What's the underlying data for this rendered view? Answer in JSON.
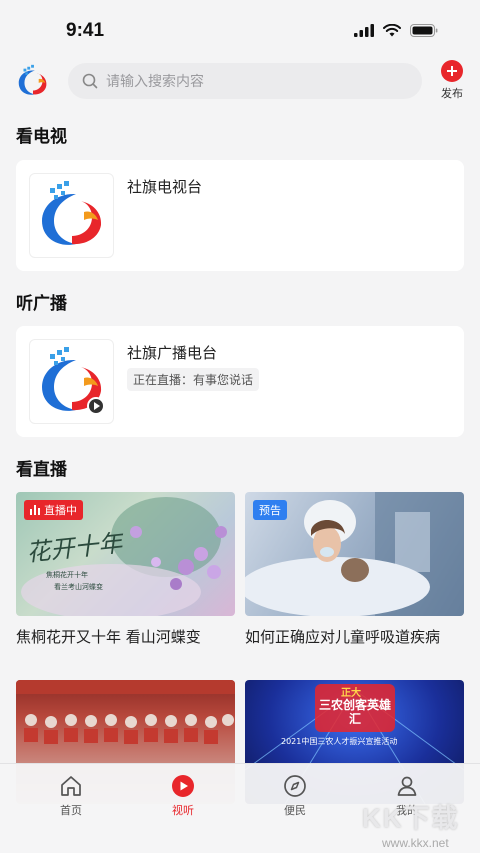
{
  "status": {
    "time": "9:41"
  },
  "header": {
    "search_placeholder": "请输入搜索内容",
    "publish_label": "发布"
  },
  "sections": {
    "tv": {
      "title": "看电视",
      "channel_name": "社旗电视台"
    },
    "radio": {
      "title": "听广播",
      "channel_name": "社旗广播电台",
      "now_playing": "正在直播：有事您说话"
    },
    "live": {
      "title": "看直播",
      "items": [
        {
          "title": "焦桐花开又十年 看山河蝶变",
          "badge": "直播中",
          "poster_text": "花开十年",
          "poster_sub1": "焦桐花开十年",
          "poster_sub2": "看兰考山河蝶变"
        },
        {
          "title": "如何正确应对儿童呼吸道疾病",
          "badge": "预告"
        },
        {
          "title": "",
          "badge": ""
        },
        {
          "title": "",
          "badge": "",
          "poster_text": "三农创客英雄汇",
          "poster_top": "正大",
          "poster_sub": "2021中国三农人才振兴宣推活动"
        }
      ]
    }
  },
  "tabbar": {
    "items": [
      {
        "label": "首页",
        "icon": "home-icon"
      },
      {
        "label": "视听",
        "icon": "play-icon",
        "active": true
      },
      {
        "label": "便民",
        "icon": "compass-icon"
      },
      {
        "label": "我的",
        "icon": "user-icon"
      }
    ]
  },
  "watermark": {
    "text": "KK下载",
    "url": "www.kkx.net"
  },
  "colors": {
    "accent": "#e8262b",
    "preview_badge": "#2f7ff0",
    "background": "#f4f4f5"
  }
}
